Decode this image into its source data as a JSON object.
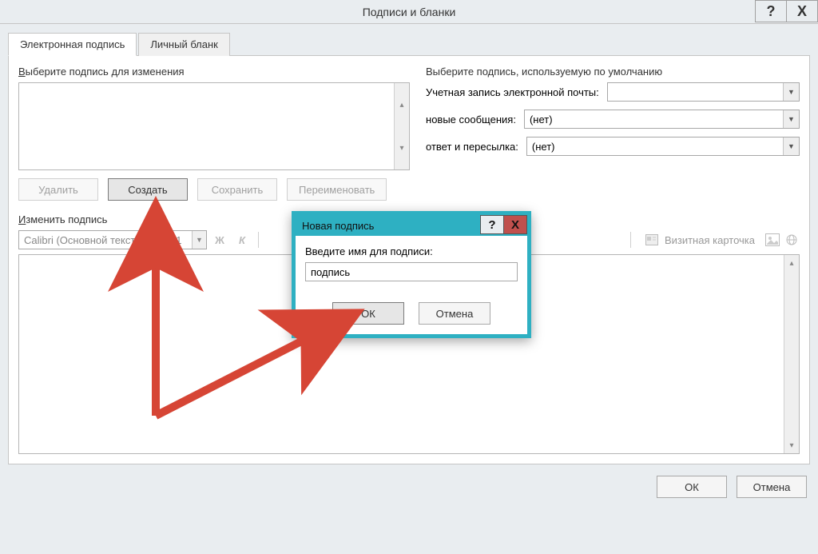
{
  "window": {
    "title": "Подписи и бланки"
  },
  "tabs": {
    "active": "Электронная подпись",
    "inactive": "Личный бланк"
  },
  "left": {
    "section_label_pre": "В",
    "section_label_rest": "ыберите подпись для изменения",
    "btn_delete": "Удалить",
    "btn_create": "Создать",
    "btn_save": "Сохранить",
    "btn_rename": "Переименовать"
  },
  "right": {
    "section_label": "Выберите подпись, используемую по умолчанию",
    "row_account_pre": "У",
    "row_account_rest": "четная запись электронной почты:",
    "row_new_pre": "н",
    "row_new_rest": "овые сообщения:",
    "row_reply_pre": "о",
    "row_reply_rest": "твет и пересылка:",
    "val_account": "",
    "val_new": "(нет)",
    "val_reply": "(нет)"
  },
  "edit": {
    "label_pre": "И",
    "label_rest": "зменить подпись",
    "font": "Calibri (Основной текст)",
    "size": "11",
    "bold": "Ж",
    "italic": "К",
    "bizcard": "Визитная карточка"
  },
  "footer": {
    "ok": "ОК",
    "cancel": "Отмена"
  },
  "modal": {
    "title": "Новая подпись",
    "label_pre": "В",
    "label_rest": "ведите имя для подписи:",
    "value": "подпись",
    "ok": "ОК",
    "cancel": "Отмена"
  },
  "icons": {
    "help": "?",
    "close": "X"
  }
}
